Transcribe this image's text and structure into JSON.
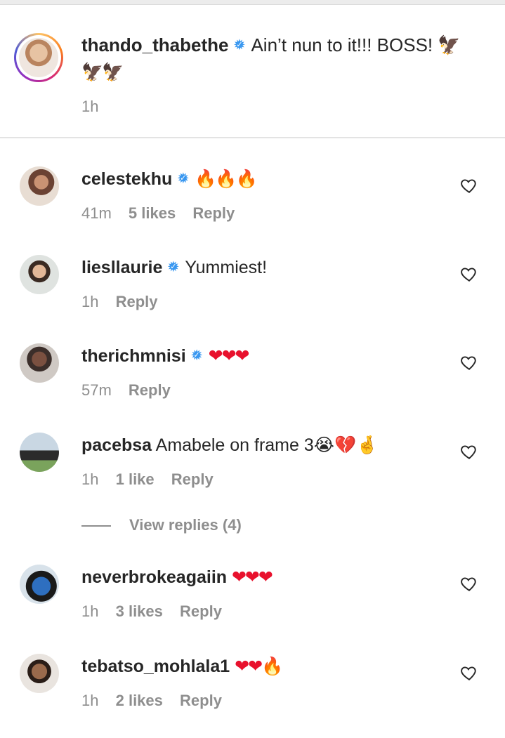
{
  "caption": {
    "username": "thando_thabethe",
    "text": "Ain’t nun to it!!! BOSS! 🦅",
    "text_line2": "🦅🦅",
    "time": "1h"
  },
  "comments": [
    {
      "username": "celestekhu",
      "verified": true,
      "text": "🔥🔥🔥",
      "time": "41m",
      "likes": "5 likes",
      "reply": "Reply"
    },
    {
      "username": "liesllaurie",
      "verified": true,
      "text": "Yummiest!",
      "time": "1h",
      "likes": "",
      "reply": "Reply"
    },
    {
      "username": "therichmnisi",
      "verified": true,
      "text": "❤❤❤",
      "time": "57m",
      "likes": "",
      "reply": "Reply"
    },
    {
      "username": "pacebsa",
      "verified": false,
      "text": "Amabele on frame 3😭💔🤞",
      "time": "1h",
      "likes": "1 like",
      "reply": "Reply"
    },
    {
      "username": "neverbrokeagaiin",
      "verified": false,
      "text": "❤❤❤",
      "time": "1h",
      "likes": "3 likes",
      "reply": "Reply"
    },
    {
      "username": "tebatso_mohlala1",
      "verified": false,
      "text": "❤❤🔥",
      "time": "1h",
      "likes": "2 likes",
      "reply": "Reply"
    }
  ],
  "view_replies": "View replies (4)",
  "colors": {
    "verified": "#3897f0",
    "meta": "#8e8e8e",
    "heart": "#e8112d",
    "fire": "#ff6a00"
  },
  "icons": {
    "like": "heart-outline-icon",
    "verified": "verified-badge-icon"
  }
}
